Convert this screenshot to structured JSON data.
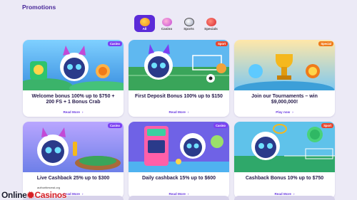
{
  "page": {
    "title": "Promotions"
  },
  "filters": [
    {
      "label": "All",
      "icon": "all-icon",
      "active": true
    },
    {
      "label": "Casino",
      "icon": "casino-icon",
      "active": false
    },
    {
      "label": "Sports",
      "icon": "sports-icon",
      "active": false
    },
    {
      "label": "Specials",
      "icon": "specials-icon",
      "active": false
    }
  ],
  "cards": [
    {
      "badge": "Casino",
      "title": "Welcome bonus 100% up to $750 + 200 FS + 1 Bonus Crab",
      "more": "Read More"
    },
    {
      "badge": "Sport",
      "title": "First Deposit Bonus 100% up to $150",
      "more": "Read More"
    },
    {
      "badge": "Special",
      "title": "Join our Tournaments – win $9,000,000!",
      "more": "Play now"
    },
    {
      "badge": "Casino",
      "title": "Live Cashback 25% up to $300",
      "more": "Read More"
    },
    {
      "badge": "Casino",
      "title": "Daily cashback 15% up to $600",
      "more": "Read More"
    },
    {
      "badge": "Sport",
      "title": "Cashback Bonus 10% up to $750",
      "more": "Read More"
    }
  ],
  "colors": {
    "accent": "#5b2bd8",
    "casino_badge": "#7b3ff2",
    "sport_badge": "#e8452c",
    "special_badge": "#f07b1a"
  },
  "watermark": {
    "url": "authoritiesreal.org",
    "brand_left": "Online",
    "brand_right": "Casinos"
  }
}
